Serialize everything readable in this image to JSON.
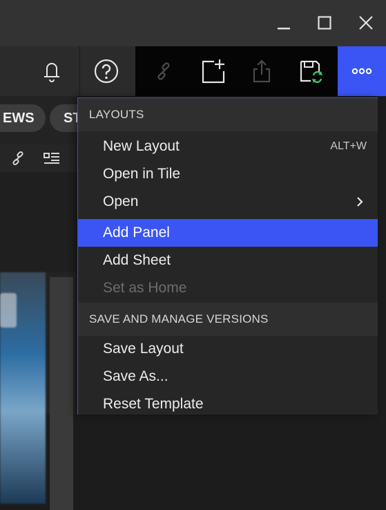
{
  "window": {
    "controls": [
      {
        "name": "minimize",
        "icon": "minimize-icon"
      },
      {
        "name": "maximize",
        "icon": "maximize-icon"
      },
      {
        "name": "close",
        "icon": "close-icon"
      }
    ]
  },
  "toolbar": {
    "icons": [
      "bell-icon",
      "help-icon",
      "link-icon",
      "new-tile-icon",
      "share-icon",
      "save-layout-icon",
      "more-icon"
    ],
    "accent_color": "#3b55f5"
  },
  "background": {
    "pills": [
      "EWS",
      "ST"
    ],
    "tool_icons": [
      "link-icon",
      "list-icon"
    ]
  },
  "menu": {
    "sections": [
      {
        "header": "LAYOUTS",
        "items": [
          {
            "label": "New Layout",
            "shortcut": "ALT+W"
          },
          {
            "label": "Open in Tile"
          },
          {
            "label": "Open",
            "submenu": true
          },
          {
            "label": "Add Panel",
            "highlighted": true
          },
          {
            "label": "Add Sheet"
          },
          {
            "label": "Set as Home",
            "disabled": true
          }
        ]
      },
      {
        "header": "SAVE AND MANAGE VERSIONS",
        "items": [
          {
            "label": "Save Layout"
          },
          {
            "label": "Save As..."
          },
          {
            "label": "Reset Template"
          }
        ]
      }
    ]
  }
}
